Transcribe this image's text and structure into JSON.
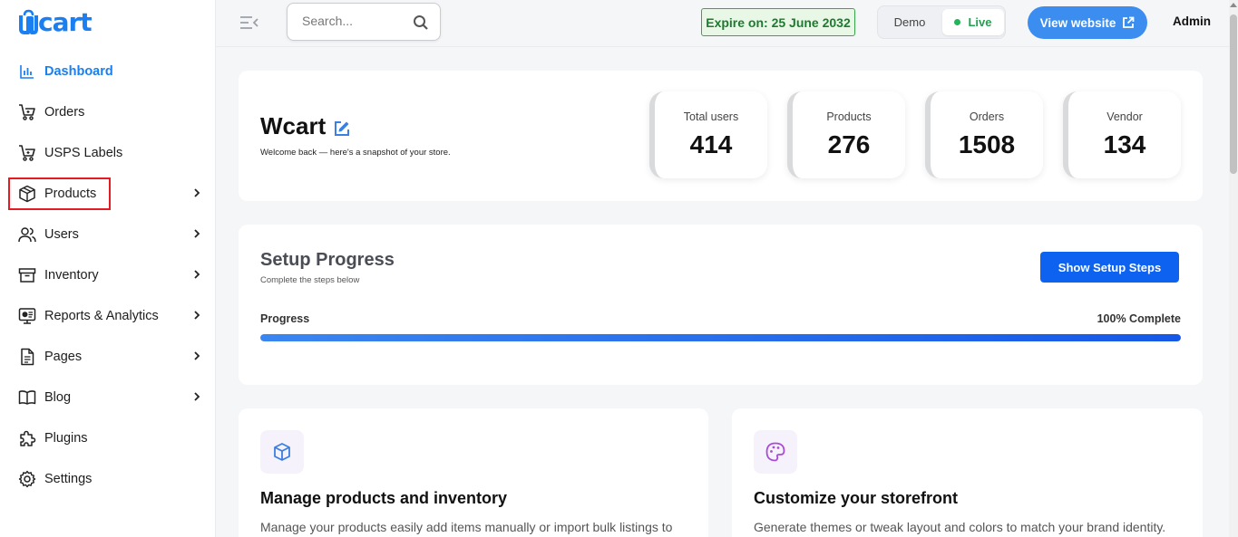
{
  "brand": {
    "logo_text": "Wcart",
    "accent": "#1a7ff0"
  },
  "sidebar": {
    "items": [
      {
        "label": "Dashboard",
        "icon": "bar-chart-icon",
        "active": true,
        "has_submenu": false
      },
      {
        "label": "Orders",
        "icon": "cart-icon",
        "has_submenu": false
      },
      {
        "label": "USPS Labels",
        "icon": "cart-icon",
        "has_submenu": false
      },
      {
        "label": "Products",
        "icon": "box-icon",
        "has_submenu": true,
        "highlighted": true
      },
      {
        "label": "Users",
        "icon": "users-icon",
        "has_submenu": true
      },
      {
        "label": "Inventory",
        "icon": "archive-icon",
        "has_submenu": true
      },
      {
        "label": "Reports & Analytics",
        "icon": "report-icon",
        "has_submenu": true
      },
      {
        "label": "Pages",
        "icon": "document-icon",
        "has_submenu": true
      },
      {
        "label": "Blog",
        "icon": "book-icon",
        "has_submenu": true
      },
      {
        "label": "Plugins",
        "icon": "puzzle-icon",
        "has_submenu": false
      },
      {
        "label": "Settings",
        "icon": "gear-icon",
        "has_submenu": false
      }
    ]
  },
  "topbar": {
    "search_placeholder": "Search...",
    "expire_text": "Expire on: 25 June 2032",
    "mode_demo": "Demo",
    "mode_live": "Live",
    "view_website": "View website",
    "user": "Admin"
  },
  "store": {
    "name": "Wcart",
    "subtitle": "Welcome back — here's a snapshot of your store.",
    "stats": [
      {
        "label": "Total users",
        "value": "414"
      },
      {
        "label": "Products",
        "value": "276"
      },
      {
        "label": "Orders",
        "value": "1508"
      },
      {
        "label": "Vendor",
        "value": "134"
      }
    ]
  },
  "setup": {
    "title": "Setup Progress",
    "subtitle": "Complete the steps below",
    "button": "Show Setup Steps",
    "progress_label": "Progress",
    "progress_text": "100% Complete",
    "progress_fraction": 1.0
  },
  "features": [
    {
      "title": "Manage products and inventory",
      "desc": "Manage your products easily add items manually or import bulk listings to",
      "icon": "cube-icon",
      "icon_color": "#3b7fe0"
    },
    {
      "title": "Customize your storefront",
      "desc": "Generate themes or tweak layout and colors to match your brand identity.",
      "icon": "palette-icon",
      "icon_color": "#a74bd8"
    }
  ]
}
